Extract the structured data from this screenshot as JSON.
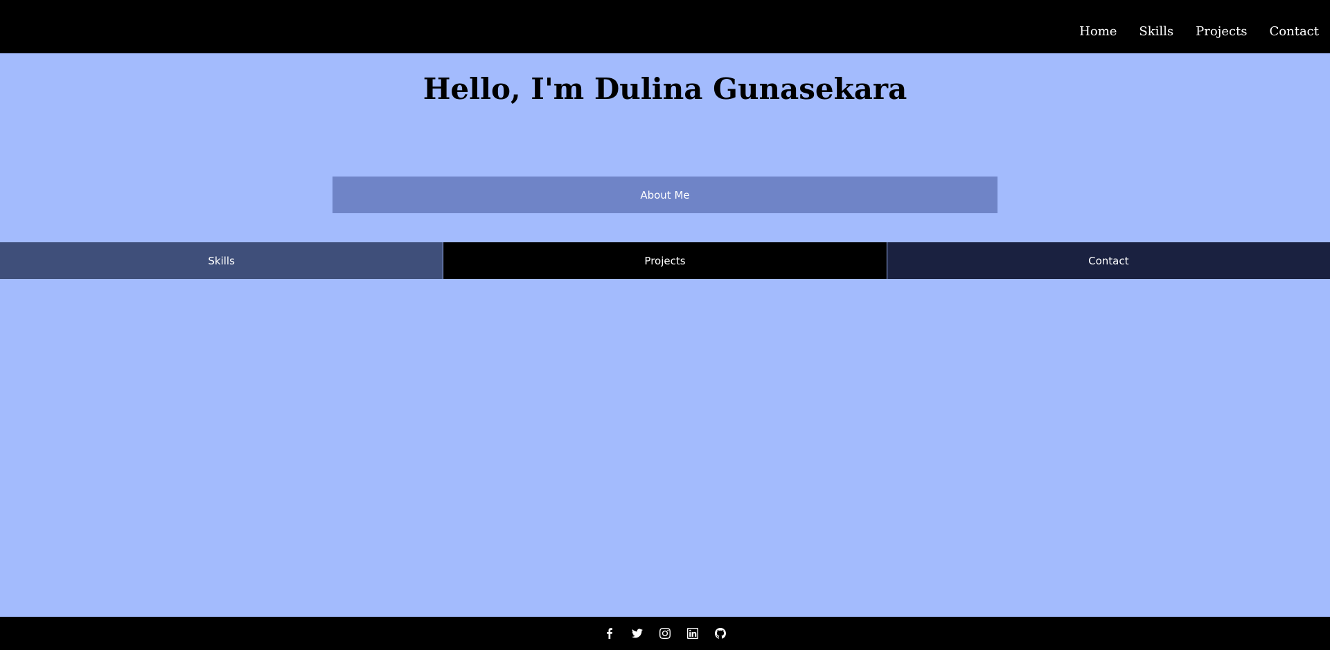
{
  "nav": {
    "items": [
      {
        "label": "Home"
      },
      {
        "label": "Skills"
      },
      {
        "label": "Projects"
      },
      {
        "label": "Contact"
      }
    ]
  },
  "hero": {
    "title": "Hello, I'm Dulina Gunasekara"
  },
  "about": {
    "label": "About Me"
  },
  "sections": {
    "skills": "Skills",
    "projects": "Projects",
    "contact": "Contact"
  },
  "footer": {
    "icons": [
      "facebook-icon",
      "twitter-icon",
      "instagram-icon",
      "linkedin-icon",
      "github-icon"
    ]
  },
  "colors": {
    "page_bg": "#a3bbfd",
    "nav_bg": "#000000",
    "about_bg": "#6f84c7",
    "skills_bg": "#3f4f7a",
    "projects_bg": "#000000",
    "contact_bg": "#1a2140"
  }
}
